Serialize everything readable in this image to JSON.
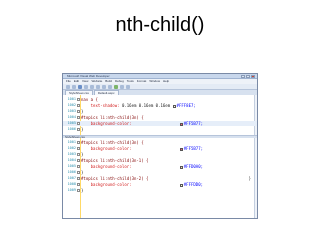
{
  "slide": {
    "title": "nth-child()"
  },
  "window": {
    "title": "Microsoft Visual Web Developer",
    "menu": [
      "File",
      "Edit",
      "View",
      "Website",
      "Build",
      "Debug",
      "Tools",
      "Format",
      "Window",
      "Help"
    ]
  },
  "tabs": [
    "StyleSheet.css",
    "Default.aspx"
  ],
  "editor_top": {
    "lines": [
      {
        "num": "1001",
        "parts": [
          {
            "t": "sel",
            "v": "nav a {"
          }
        ]
      },
      {
        "num": "1002",
        "parts": [
          {
            "t": "prop",
            "v": "    text-shadow: "
          },
          {
            "t": "plain",
            "v": "0.16em 0.16em 0.16em "
          },
          {
            "t": "swatch",
            "v": "#FFF8E7"
          },
          {
            "t": "val",
            "v": "#FFF8E7;"
          }
        ]
      },
      {
        "num": "1003",
        "parts": [
          {
            "t": "plain",
            "v": "}"
          }
        ]
      },
      {
        "num": "1004",
        "parts": [
          {
            "t": "sel",
            "v": "#topics li:nth-child(3n) {"
          }
        ]
      },
      {
        "num": "1005",
        "parts": [
          {
            "t": "prop",
            "v": "    background-color:"
          },
          {
            "t": "plain",
            "v": "                    "
          },
          {
            "t": "swatch",
            "v": "#FF5B77"
          },
          {
            "t": "val",
            "v": "#FF5B77;"
          }
        ]
      },
      {
        "num": "1006",
        "parts": [
          {
            "t": "plain",
            "v": "}"
          }
        ]
      }
    ]
  },
  "splitter_label": "StyleSheet.css",
  "editor_bottom": {
    "lines": [
      {
        "num": "1001",
        "parts": [
          {
            "t": "sel",
            "v": "#topics li:nth-child(3n) {"
          }
        ]
      },
      {
        "num": "1002",
        "parts": [
          {
            "t": "prop",
            "v": "    background-color:"
          },
          {
            "t": "plain",
            "v": "                    "
          },
          {
            "t": "swatch",
            "v": "#FF5B77"
          },
          {
            "t": "val",
            "v": "#FF5B77;"
          }
        ]
      },
      {
        "num": "1003",
        "parts": [
          {
            "t": "plain",
            "v": "}"
          }
        ]
      },
      {
        "num": "1004",
        "parts": [
          {
            "t": "sel",
            "v": "#topics li:nth-child(3n-1) {"
          }
        ]
      },
      {
        "num": "1005",
        "parts": [
          {
            "t": "prop",
            "v": "    background-color:"
          },
          {
            "t": "plain",
            "v": "                    "
          },
          {
            "t": "swatch",
            "v": "#FFD0A0"
          },
          {
            "t": "val",
            "v": "#FFD0A0;"
          }
        ]
      },
      {
        "num": "1006",
        "parts": [
          {
            "t": "plain",
            "v": "}"
          }
        ]
      },
      {
        "num": "1007",
        "parts": [
          {
            "t": "sel",
            "v": "#topics li:nth-child(3n-2) {"
          }
        ]
      },
      {
        "num": "1008",
        "parts": [
          {
            "t": "prop",
            "v": "    background-color:"
          },
          {
            "t": "plain",
            "v": "                    "
          },
          {
            "t": "swatch",
            "v": "#FFFDD0"
          },
          {
            "t": "val",
            "v": "#FFFDD0;"
          }
        ]
      },
      {
        "num": "1009",
        "parts": [
          {
            "t": "plain",
            "v": "}"
          }
        ]
      }
    ]
  },
  "right_marker": "}",
  "colors": {
    "selector": "#800000",
    "property": "#D11919",
    "value": "#0000FF",
    "line_number": "#2B91AF"
  }
}
